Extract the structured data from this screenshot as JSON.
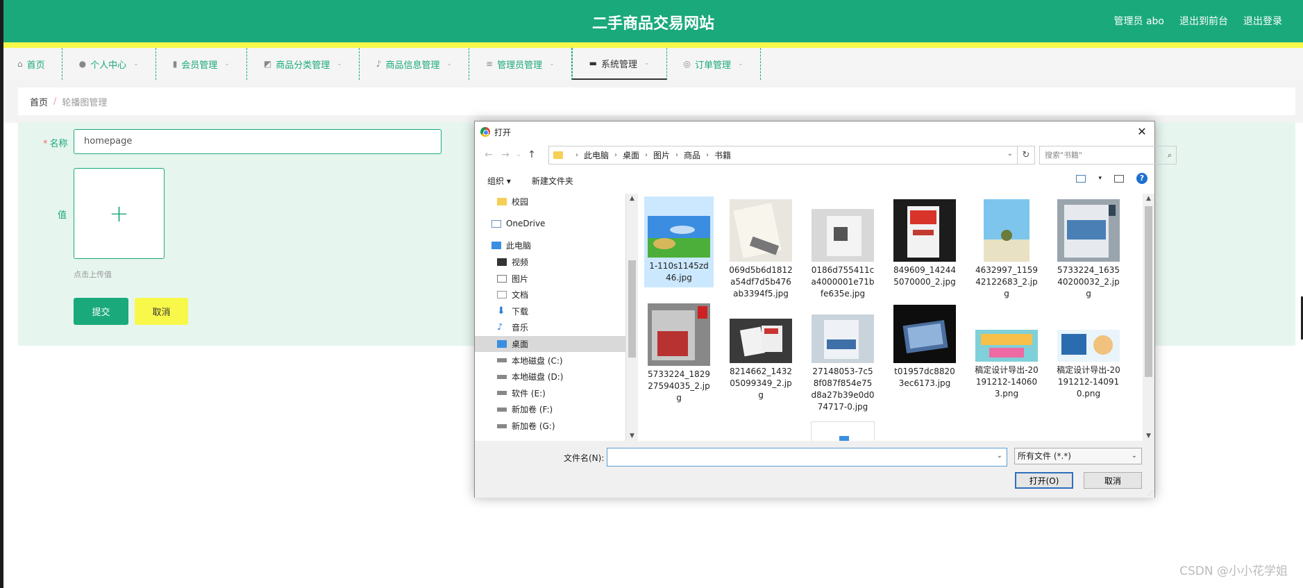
{
  "header": {
    "site_title": "二手商品交易网站",
    "admin_label": "管理员 abo",
    "back_front": "退出到前台",
    "logout": "退出登录"
  },
  "nav": [
    {
      "label": "首页",
      "icon": "home-icon"
    },
    {
      "label": "个人中心",
      "icon": "user-icon"
    },
    {
      "label": "会员管理",
      "icon": "bar-chart-icon"
    },
    {
      "label": "商品分类管理",
      "icon": "chart-icon"
    },
    {
      "label": "商品信息管理",
      "icon": "mic-icon"
    },
    {
      "label": "管理员管理",
      "icon": "list-icon"
    },
    {
      "label": "系统管理",
      "icon": "monitor-icon"
    },
    {
      "label": "订单管理",
      "icon": "circle-icon"
    }
  ],
  "breadcrumb": {
    "home": "首页",
    "separator": "/",
    "current": "轮播图管理"
  },
  "form": {
    "name_label": "名称",
    "name_value": "homepage",
    "value_label": "值",
    "upload_plus": "+",
    "upload_hint": "点击上传值",
    "submit": "提交",
    "cancel": "取消"
  },
  "dialog": {
    "title": "打开",
    "close": "✕",
    "path": [
      "此电脑",
      "桌面",
      "图片",
      "商品",
      "书籍"
    ],
    "search_placeholder": "搜索\"书籍\"",
    "organize": "组织 ▾",
    "new_folder": "新建文件夹",
    "sidebar": [
      {
        "label": "校园",
        "icon": "folder-icon"
      },
      {
        "label": "",
        "icon": ""
      },
      {
        "label": "OneDrive",
        "icon": "cloud-icon"
      },
      {
        "label": "",
        "icon": ""
      },
      {
        "label": "此电脑",
        "icon": "computer-icon"
      },
      {
        "label": "视频",
        "icon": "video-icon"
      },
      {
        "label": "图片",
        "icon": "picture-icon"
      },
      {
        "label": "文档",
        "icon": "document-icon"
      },
      {
        "label": "下载",
        "icon": "download-icon"
      },
      {
        "label": "音乐",
        "icon": "music-icon"
      },
      {
        "label": "桌面",
        "icon": "desktop-icon",
        "selected": true
      },
      {
        "label": "本地磁盘 (C:)",
        "icon": "drive-icon"
      },
      {
        "label": "本地磁盘 (D:)",
        "icon": "drive-icon"
      },
      {
        "label": "软件 (E:)",
        "icon": "drive-icon"
      },
      {
        "label": "新加卷 (F:)",
        "icon": "drive-icon"
      },
      {
        "label": "新加卷 (G:)",
        "icon": "drive-icon"
      }
    ],
    "files": [
      {
        "name": "1-110s1145zd46.jpg",
        "selected": true
      },
      {
        "name": "069d5b6d1812a54df7d5b476ab3394f5.jpg"
      },
      {
        "name": "0186d755411ca4000001e71bfe635e.jpg"
      },
      {
        "name": "849609_142445070000_2.jpg"
      },
      {
        "name": "4632997_115942122683_2.jpg"
      },
      {
        "name": "5733224_163540200032_2.jpg"
      },
      {
        "name": "5733224_182927594035_2.jpg"
      },
      {
        "name": "8214662_143205099349_2.jpg"
      },
      {
        "name": "27148053-7c58f087f854e75d8a27b39e0d074717-0.jpg"
      },
      {
        "name": "t01957dc88203ec6173.jpg"
      },
      {
        "name": "稿定设计导出-20191212-140603.png"
      },
      {
        "name": "稿定设计导出-20191212-140910.png"
      }
    ],
    "filename_label": "文件名(N):",
    "filename_value": "",
    "filetype": "所有文件 (*.*)",
    "open_button": "打开(O)",
    "cancel_button": "取消"
  },
  "watermark": "CSDN @小小花学姐",
  "colors": {
    "brand": "#1aa97b",
    "accent_yellow": "#f8f84a",
    "danger": "#f56c6c"
  }
}
